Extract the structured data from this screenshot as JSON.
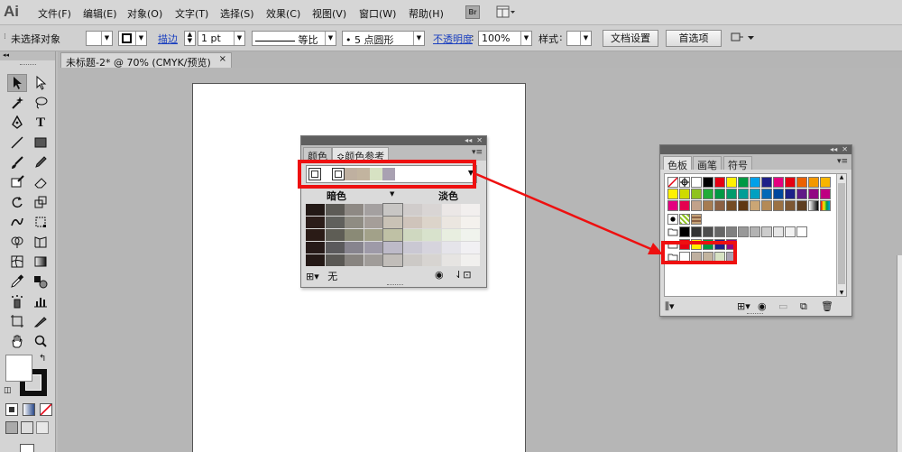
{
  "app": {
    "logo": "Ai",
    "menus": [
      "文件(F)",
      "编辑(E)",
      "对象(O)",
      "文字(T)",
      "选择(S)",
      "效果(C)",
      "视图(V)",
      "窗口(W)",
      "帮助(H)"
    ],
    "bridge_label": "Br"
  },
  "controlbar": {
    "selection_status": "未选择对象",
    "stroke_label": "描边",
    "stroke_weight": "1 pt",
    "stroke_profile": "等比",
    "brush": "5 点圆形",
    "opacity_label": "不透明度",
    "opacity_value": "100%",
    "style_label": "样式",
    "doc_setup": "文档设置",
    "preferences": "首选项"
  },
  "document": {
    "tab_title": "未标题-2* @ 70% (CMYK/预览)",
    "close": "×"
  },
  "color_guide_panel": {
    "tabs": [
      "颜色",
      "颜色参考"
    ],
    "active_tab_index": 1,
    "dark_label": "暗色",
    "light_label": "淡色",
    "none_label": "无",
    "harmony_colors": [
      "#bfb0a0",
      "#c2b49f",
      "#d7e2c3",
      "#a9a1b2"
    ],
    "grid_rows": [
      [
        "#231916",
        "#5d5b56",
        "#8e8984",
        "#a4a0a0",
        "#c8c6c4",
        "#d0cccb",
        "#d9d5d4",
        "#ebe7e6",
        "#f2efee"
      ],
      [
        "#2b1d19",
        "#60605c",
        "#8f8c83",
        "#a59e99",
        "#c9c2b6",
        "#cfc4bb",
        "#dcd4ca",
        "#ebe6e0",
        "#f4f1ed"
      ],
      [
        "#2a1b16",
        "#5e5d55",
        "#8a8a76",
        "#a2a189",
        "#bfc1a5",
        "#cfd8c0",
        "#d8e2cc",
        "#e8eee0",
        "#f0f3ed"
      ],
      [
        "#261a18",
        "#5b5a5c",
        "#87848e",
        "#9e9aa8",
        "#bdbac8",
        "#cac8d3",
        "#d6d4dd",
        "#e5e4ea",
        "#f1f0f3"
      ],
      [
        "#241916",
        "#5a5854",
        "#888480",
        "#a09c99",
        "#c1bdb9",
        "#ccc9c6",
        "#d7d4d1",
        "#e6e4e2",
        "#f1f0ee"
      ]
    ]
  },
  "swatches_panel": {
    "tabs": [
      "色板",
      "画笔",
      "符号"
    ],
    "active_tab_index": 0,
    "swatch_rows": [
      [
        "none",
        "register",
        "#ffffff",
        "#000000",
        "#e60012",
        "#fff100",
        "#009944",
        "#00a0e9",
        "#1d2088",
        "#e4007f",
        "#e60012",
        "#eb6100",
        "#f39800",
        "#f8b500"
      ],
      [
        "#fff100",
        "#cfdb00",
        "#8fc31f",
        "#22ac38",
        "#009944",
        "#009b6b",
        "#009e96",
        "#00a0c1",
        "#0068b7",
        "#00479d",
        "#1d2088",
        "#601986",
        "#920783",
        "#be0081"
      ],
      [
        "#e4007f",
        "#e5004f",
        "#c2a28a",
        "#a67c52",
        "#8b6043",
        "#754c24",
        "#603813",
        "#cba675",
        "#b48a57",
        "#9b7143",
        "#7d5733",
        "#5e3e21",
        "#gradient1",
        "#gradient2"
      ],
      [
        "pattern-a",
        "pattern-b",
        "pattern-c"
      ],
      [
        "folder",
        "#000000",
        "#333333",
        "#4d4d4d",
        "#666666",
        "#808080",
        "#999999",
        "#b3b3b3",
        "#cccccc",
        "#e6e6e6",
        "#f2f2f2",
        "#ffffff"
      ],
      [
        "folder",
        "#e60012",
        "#fff100",
        "#009944",
        "#1d2088",
        "#920783"
      ],
      [
        "folder",
        "#ffffff",
        "#bfb0a0",
        "#c2b49f",
        "#d7e2c3",
        "#a9a1b2"
      ]
    ]
  },
  "colors": {
    "highlight_red": "#ee1010",
    "chrome_gray": "#d4d4d4"
  }
}
